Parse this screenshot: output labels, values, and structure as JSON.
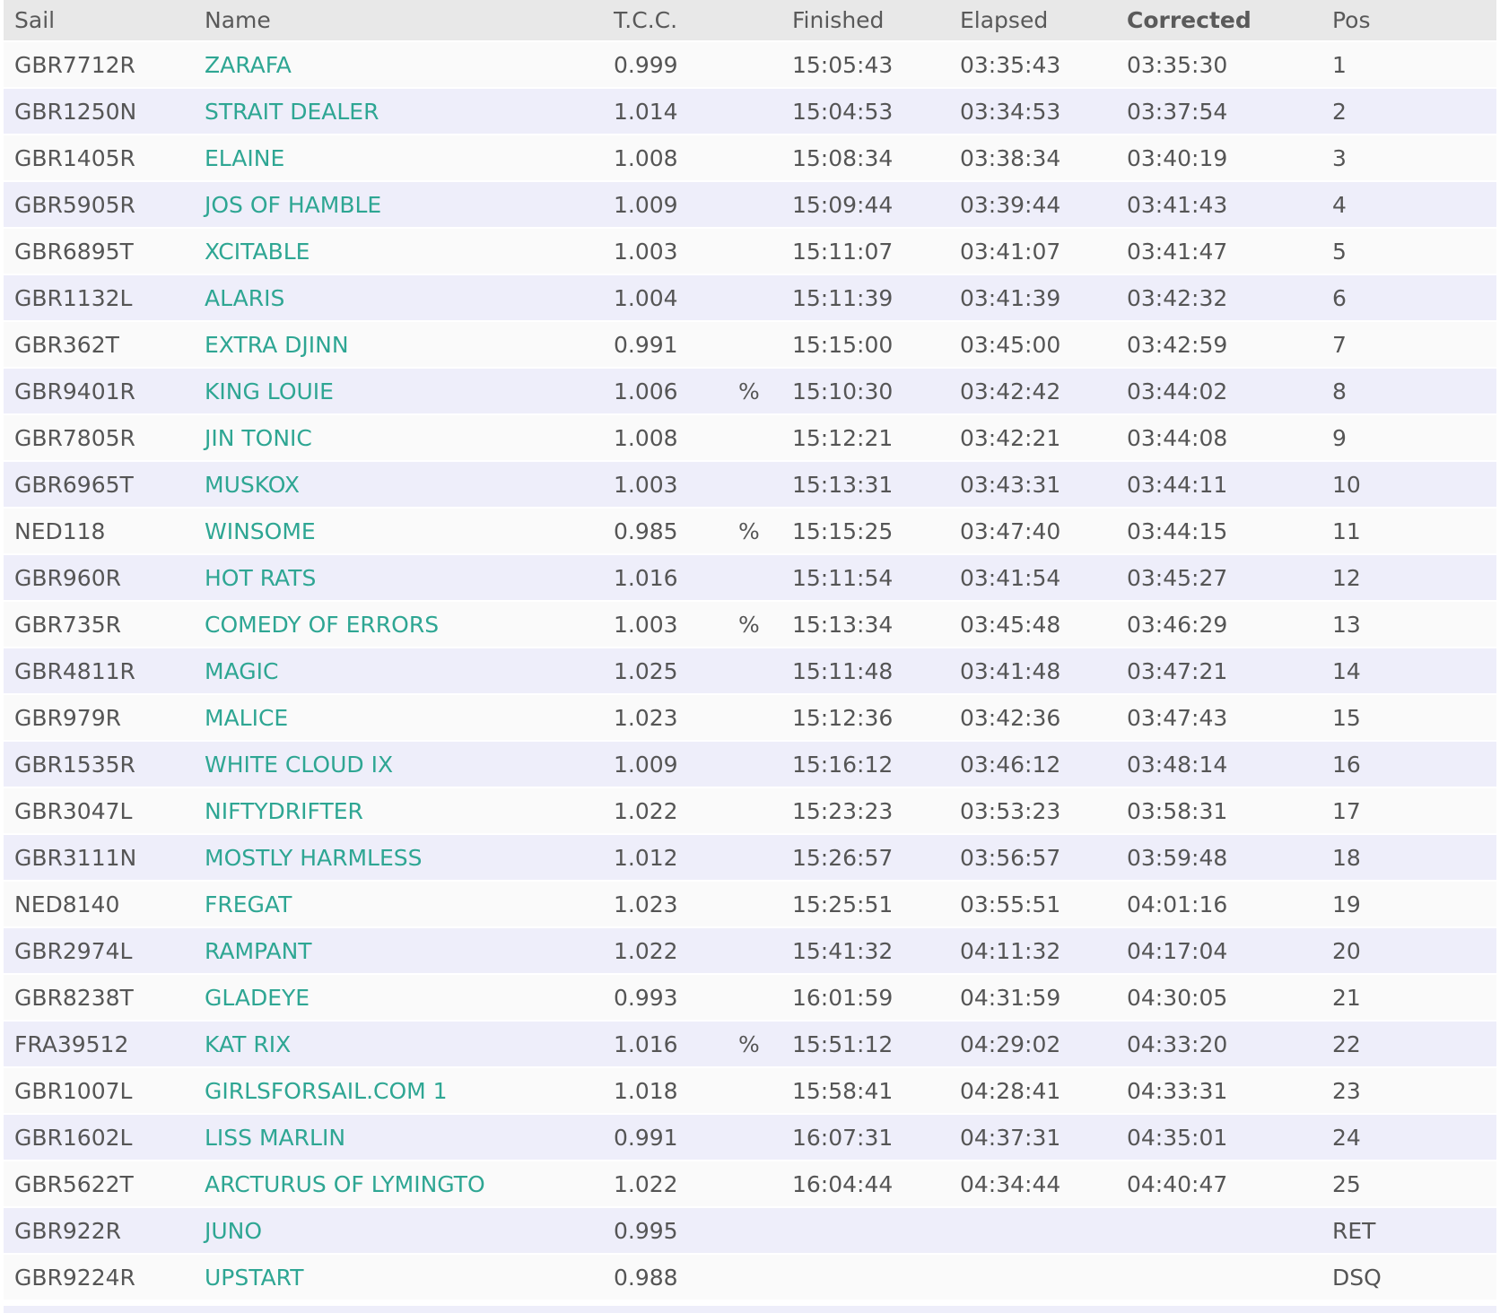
{
  "columns": {
    "sail": "Sail",
    "name": "Name",
    "tcc": "T.C.C.",
    "flag": "",
    "finished": "Finished",
    "elapsed": "Elapsed",
    "corrected": "Corrected",
    "pos": "Pos"
  },
  "sorted_column": "corrected",
  "colors": {
    "link": "#2ea693",
    "header_bg": "#e8e8e8",
    "row_odd": "#fafafa",
    "row_even": "#eeeefa",
    "text": "#555555"
  },
  "rows": [
    {
      "sail": "GBR7712R",
      "name": "ZARAFA",
      "tcc": "0.999",
      "flag": "",
      "finished": "15:05:43",
      "elapsed": "03:35:43",
      "corrected": "03:35:30",
      "pos": "1"
    },
    {
      "sail": "GBR1250N",
      "name": "STRAIT DEALER",
      "tcc": "1.014",
      "flag": "",
      "finished": "15:04:53",
      "elapsed": "03:34:53",
      "corrected": "03:37:54",
      "pos": "2"
    },
    {
      "sail": "GBR1405R",
      "name": "ELAINE",
      "tcc": "1.008",
      "flag": "",
      "finished": "15:08:34",
      "elapsed": "03:38:34",
      "corrected": "03:40:19",
      "pos": "3"
    },
    {
      "sail": "GBR5905R",
      "name": "JOS OF HAMBLE",
      "tcc": "1.009",
      "flag": "",
      "finished": "15:09:44",
      "elapsed": "03:39:44",
      "corrected": "03:41:43",
      "pos": "4"
    },
    {
      "sail": "GBR6895T",
      "name": "XCITABLE",
      "tcc": "1.003",
      "flag": "",
      "finished": "15:11:07",
      "elapsed": "03:41:07",
      "corrected": "03:41:47",
      "pos": "5"
    },
    {
      "sail": "GBR1132L",
      "name": "ALARIS",
      "tcc": "1.004",
      "flag": "",
      "finished": "15:11:39",
      "elapsed": "03:41:39",
      "corrected": "03:42:32",
      "pos": "6"
    },
    {
      "sail": "GBR362T",
      "name": "EXTRA DJINN",
      "tcc": "0.991",
      "flag": "",
      "finished": "15:15:00",
      "elapsed": "03:45:00",
      "corrected": "03:42:59",
      "pos": "7"
    },
    {
      "sail": "GBR9401R",
      "name": "KING LOUIE",
      "tcc": "1.006",
      "flag": "%",
      "finished": "15:10:30",
      "elapsed": "03:42:42",
      "corrected": "03:44:02",
      "pos": "8"
    },
    {
      "sail": "GBR7805R",
      "name": "JIN TONIC",
      "tcc": "1.008",
      "flag": "",
      "finished": "15:12:21",
      "elapsed": "03:42:21",
      "corrected": "03:44:08",
      "pos": "9"
    },
    {
      "sail": "GBR6965T",
      "name": "MUSKOX",
      "tcc": "1.003",
      "flag": "",
      "finished": "15:13:31",
      "elapsed": "03:43:31",
      "corrected": "03:44:11",
      "pos": "10"
    },
    {
      "sail": "NED118",
      "name": "WINSOME",
      "tcc": "0.985",
      "flag": "%",
      "finished": "15:15:25",
      "elapsed": "03:47:40",
      "corrected": "03:44:15",
      "pos": "11"
    },
    {
      "sail": "GBR960R",
      "name": "HOT RATS",
      "tcc": "1.016",
      "flag": "",
      "finished": "15:11:54",
      "elapsed": "03:41:54",
      "corrected": "03:45:27",
      "pos": "12"
    },
    {
      "sail": "GBR735R",
      "name": "COMEDY OF ERRORS",
      "tcc": "1.003",
      "flag": "%",
      "finished": "15:13:34",
      "elapsed": "03:45:48",
      "corrected": "03:46:29",
      "pos": "13"
    },
    {
      "sail": "GBR4811R",
      "name": "MAGIC",
      "tcc": "1.025",
      "flag": "",
      "finished": "15:11:48",
      "elapsed": "03:41:48",
      "corrected": "03:47:21",
      "pos": "14"
    },
    {
      "sail": "GBR979R",
      "name": "MALICE",
      "tcc": "1.023",
      "flag": "",
      "finished": "15:12:36",
      "elapsed": "03:42:36",
      "corrected": "03:47:43",
      "pos": "15"
    },
    {
      "sail": "GBR1535R",
      "name": "WHITE CLOUD IX",
      "tcc": "1.009",
      "flag": "",
      "finished": "15:16:12",
      "elapsed": "03:46:12",
      "corrected": "03:48:14",
      "pos": "16"
    },
    {
      "sail": "GBR3047L",
      "name": "NIFTYDRIFTER",
      "tcc": "1.022",
      "flag": "",
      "finished": "15:23:23",
      "elapsed": "03:53:23",
      "corrected": "03:58:31",
      "pos": "17"
    },
    {
      "sail": "GBR3111N",
      "name": "MOSTLY HARMLESS",
      "tcc": "1.012",
      "flag": "",
      "finished": "15:26:57",
      "elapsed": "03:56:57",
      "corrected": "03:59:48",
      "pos": "18"
    },
    {
      "sail": "NED8140",
      "name": "FREGAT",
      "tcc": "1.023",
      "flag": "",
      "finished": "15:25:51",
      "elapsed": "03:55:51",
      "corrected": "04:01:16",
      "pos": "19"
    },
    {
      "sail": "GBR2974L",
      "name": "RAMPANT",
      "tcc": "1.022",
      "flag": "",
      "finished": "15:41:32",
      "elapsed": "04:11:32",
      "corrected": "04:17:04",
      "pos": "20"
    },
    {
      "sail": "GBR8238T",
      "name": "GLADEYE",
      "tcc": "0.993",
      "flag": "",
      "finished": "16:01:59",
      "elapsed": "04:31:59",
      "corrected": "04:30:05",
      "pos": "21"
    },
    {
      "sail": "FRA39512",
      "name": "KAT RIX",
      "tcc": "1.016",
      "flag": "%",
      "finished": "15:51:12",
      "elapsed": "04:29:02",
      "corrected": "04:33:20",
      "pos": "22"
    },
    {
      "sail": "GBR1007L",
      "name": "GIRLSFORSAIL.COM 1",
      "tcc": "1.018",
      "flag": "",
      "finished": "15:58:41",
      "elapsed": "04:28:41",
      "corrected": "04:33:31",
      "pos": "23"
    },
    {
      "sail": "GBR1602L",
      "name": "LISS MARLIN",
      "tcc": "0.991",
      "flag": "",
      "finished": "16:07:31",
      "elapsed": "04:37:31",
      "corrected": "04:35:01",
      "pos": "24"
    },
    {
      "sail": "GBR5622T",
      "name": "ARCTURUS OF LYMINGTO",
      "tcc": "1.022",
      "flag": "",
      "finished": "16:04:44",
      "elapsed": "04:34:44",
      "corrected": "04:40:47",
      "pos": "25"
    },
    {
      "sail": "GBR922R",
      "name": "JUNO",
      "tcc": "0.995",
      "flag": "",
      "finished": "",
      "elapsed": "",
      "corrected": "",
      "pos": "RET"
    },
    {
      "sail": "GBR9224R",
      "name": "UPSTART",
      "tcc": "0.988",
      "flag": "",
      "finished": "",
      "elapsed": "",
      "corrected": "",
      "pos": "DSQ"
    }
  ]
}
